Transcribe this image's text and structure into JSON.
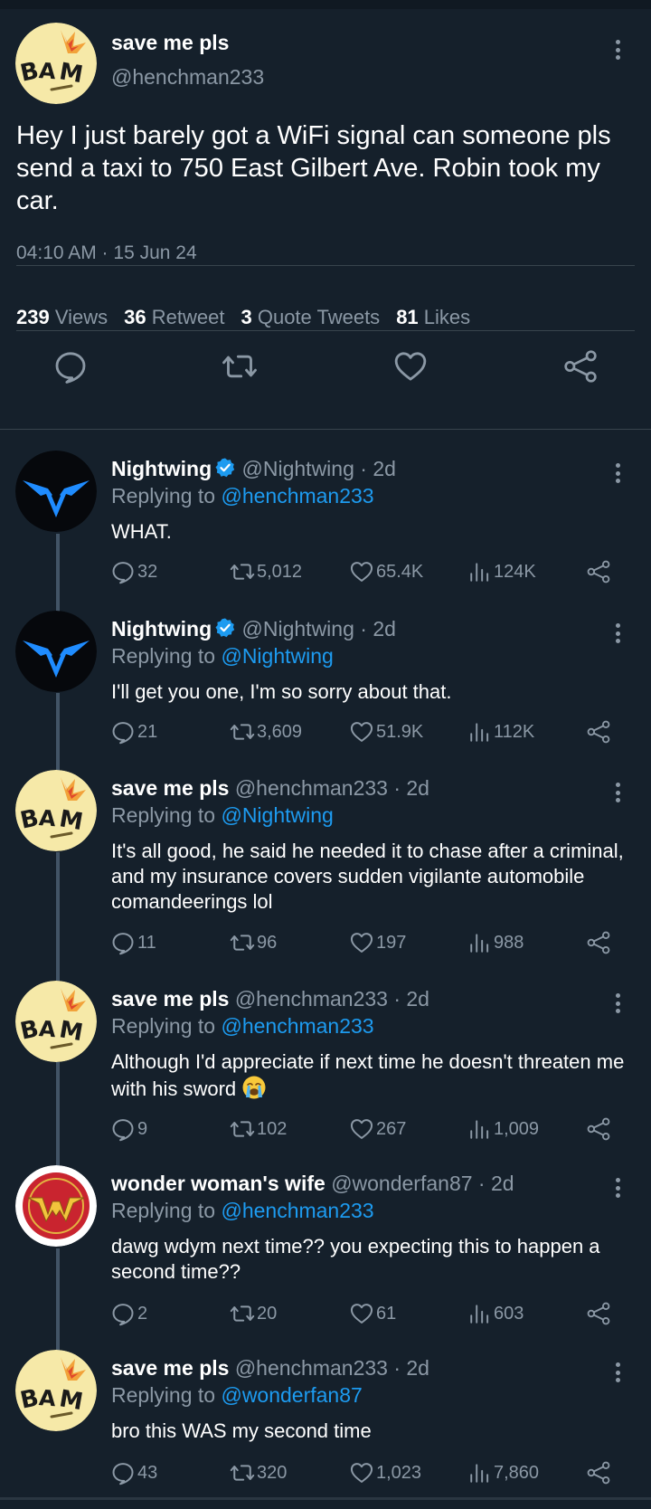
{
  "main_tweet": {
    "name": "save me pls",
    "handle": "@henchman233",
    "text": "Hey I just barely got a WiFi signal can someone pls send a taxi to 750 East Gilbert Ave. Robin took my car.",
    "timestamp": "04:10 AM · 15 Jun 24",
    "stats": {
      "views_count": "239",
      "views_label": "Views",
      "retweets_count": "36",
      "retweets_label": "Retweet",
      "quotes_count": "3",
      "quotes_label": "Quote Tweets",
      "likes_count": "81",
      "likes_label": "Likes"
    },
    "avatar_text": "BAM"
  },
  "replies": [
    {
      "name": "Nightwing",
      "verified": true,
      "handle": "@Nightwing",
      "age": "· 2d",
      "replying_prefix": "Replying to ",
      "replying_to": "@henchman233",
      "text": "WHAT.",
      "stats": {
        "replies": "32",
        "retweets": "5,012",
        "likes": "65.4K",
        "views": "124K"
      }
    },
    {
      "name": "Nightwing",
      "verified": true,
      "handle": "@Nightwing",
      "age": "· 2d",
      "replying_prefix": "Replying to ",
      "replying_to": "@Nightwing",
      "text": "I'll get you one, I'm so sorry about that.",
      "stats": {
        "replies": "21",
        "retweets": "3,609",
        "likes": "51.9K",
        "views": "112K"
      }
    },
    {
      "name": "save me pls",
      "verified": false,
      "handle": "@henchman233",
      "age": "· 2d",
      "replying_prefix": "Replying to ",
      "replying_to": "@Nightwing",
      "text": "It's all good, he said he needed it to chase after a criminal, and my insurance covers sudden vigilante automobile comandeerings lol",
      "avatar_text": "BAM",
      "stats": {
        "replies": "11",
        "retweets": "96",
        "likes": "197",
        "views": "988"
      }
    },
    {
      "name": "save me pls",
      "verified": false,
      "handle": "@henchman233",
      "age": "· 2d",
      "replying_prefix": "Replying to ",
      "replying_to": "@henchman233",
      "text": "Although I'd appreciate if next time he doesn't threaten me with his sword",
      "emoji": "loudly-crying-face",
      "avatar_text": "BAM",
      "stats": {
        "replies": "9",
        "retweets": "102",
        "likes": "267",
        "views": "1,009"
      }
    },
    {
      "name": "wonder woman's wife",
      "verified": false,
      "handle": "@wonderfan87",
      "age": "· 2d",
      "replying_prefix": "Replying to ",
      "replying_to": "@henchman233",
      "text": "dawg wdym next time?? you expecting this to happen a second time??",
      "stats": {
        "replies": "2",
        "retweets": "20",
        "likes": "61",
        "views": "603"
      }
    },
    {
      "name": "save me pls",
      "verified": false,
      "handle": "@henchman233",
      "age": "· 2d",
      "replying_prefix": "Replying to ",
      "replying_to": "@wonderfan87",
      "text": "bro this WAS my second time",
      "avatar_text": "BAM",
      "stats": {
        "replies": "43",
        "retweets": "320",
        "likes": "1,023",
        "views": "7,860"
      }
    }
  ],
  "icons": {
    "reply": "speech-bubble-icon",
    "retweet": "retweet-arrows-icon",
    "like": "heart-icon",
    "views": "bar-chart-icon",
    "share": "share-nodes-icon",
    "more": "three-dots-vertical-icon",
    "verified": "verified-badge-icon"
  },
  "colors": {
    "background": "#15202b",
    "accent": "#1d9bf0",
    "secondary_text": "#8b98a5",
    "divider": "#38444d"
  }
}
